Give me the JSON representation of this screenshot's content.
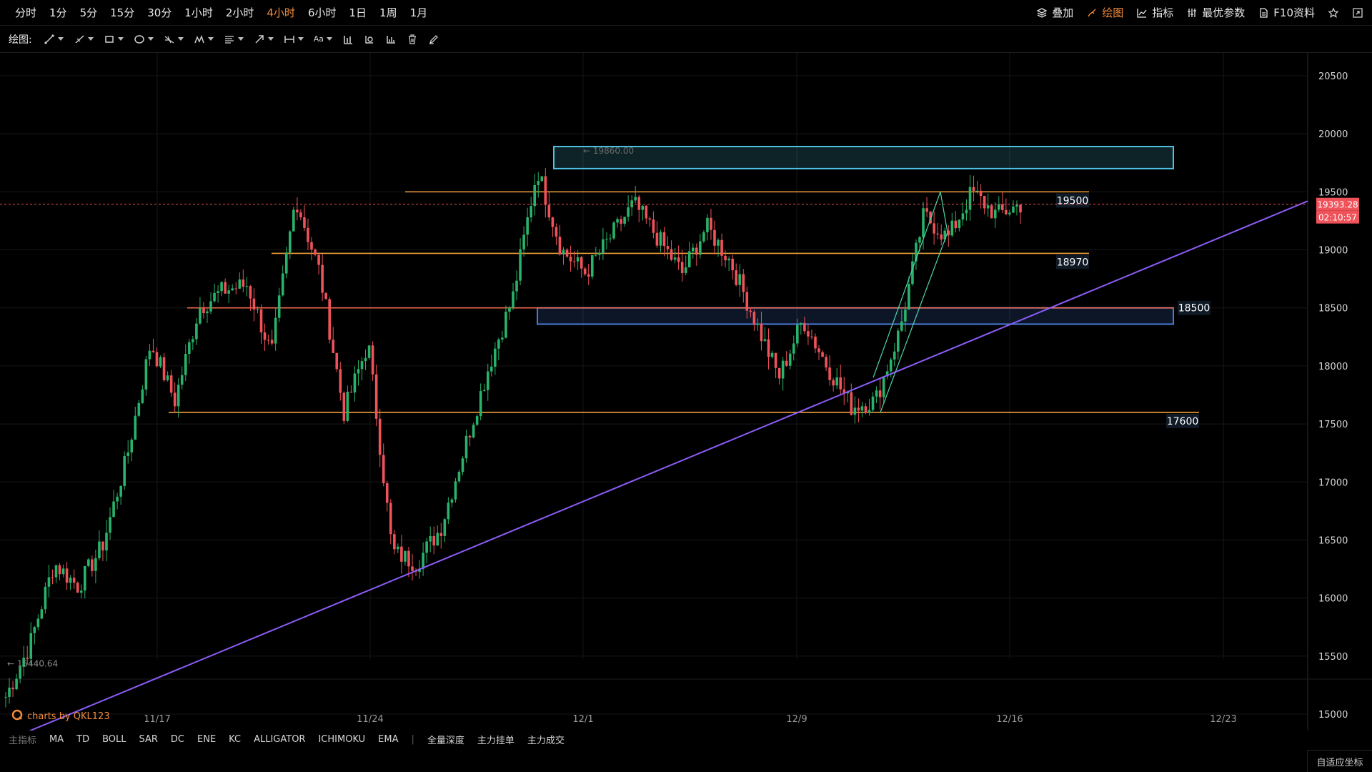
{
  "toolbar": {
    "timeframes": [
      "分时",
      "1分",
      "5分",
      "15分",
      "30分",
      "1小时",
      "2小时",
      "4小时",
      "6小时",
      "1日",
      "1周",
      "1月"
    ],
    "active_timeframe": "4小时",
    "right_items": [
      {
        "label": "叠加",
        "icon": "layers-icon",
        "active": false
      },
      {
        "label": "绘图",
        "icon": "brush-icon",
        "active": true
      },
      {
        "label": "指标",
        "icon": "indicator-icon",
        "active": false
      },
      {
        "label": "最优参数",
        "icon": "params-icon",
        "active": false
      },
      {
        "label": "F10资料",
        "icon": "document-icon",
        "active": false
      }
    ],
    "icon_buttons": [
      "star-icon",
      "fullscreen-icon"
    ]
  },
  "drawing_bar": {
    "label": "绘图:",
    "tools": [
      {
        "name": "trend-line-icon",
        "dropdown": true
      },
      {
        "name": "ray-line-icon",
        "dropdown": true
      },
      {
        "name": "rectangle-icon",
        "dropdown": true
      },
      {
        "name": "ellipse-icon",
        "dropdown": true
      },
      {
        "name": "fork-icon",
        "dropdown": true
      },
      {
        "name": "pattern-icon",
        "dropdown": true
      },
      {
        "name": "fib-icon",
        "dropdown": true
      },
      {
        "name": "arrow-icon",
        "dropdown": true
      },
      {
        "name": "measure-icon",
        "dropdown": true
      },
      {
        "name": "text-icon",
        "label": "Aa",
        "dropdown": true
      },
      {
        "name": "bars-chart-icon",
        "dropdown": false
      },
      {
        "name": "pie-chart-icon",
        "dropdown": false
      },
      {
        "name": "volume-chart-icon",
        "dropdown": false
      },
      {
        "name": "trash-icon",
        "dropdown": false
      },
      {
        "name": "pen-icon",
        "dropdown": false
      }
    ]
  },
  "indicators": {
    "label": "主指标",
    "items": [
      "MA",
      "TD",
      "BOLL",
      "SAR",
      "DC",
      "ENE",
      "KC",
      "ALLIGATOR",
      "ICHIMOKU",
      "EMA"
    ],
    "extra": [
      "全量深度",
      "主力挂单",
      "主力成交"
    ]
  },
  "watermark": "charts by QKL123",
  "auto_axis_label": "自适应坐标",
  "chart_data": {
    "type": "candlestick",
    "interval": "4h",
    "x_labels": [
      "11/17",
      "11/24",
      "12/1",
      "12/9",
      "12/16",
      "12/23"
    ],
    "ylim": [
      14800,
      20700
    ],
    "y_ticks": [
      15000,
      15500,
      16000,
      16500,
      17000,
      17500,
      18000,
      18500,
      19000,
      19500,
      20000,
      20500
    ],
    "current_price": "19393.28",
    "countdown": "02:10:57",
    "high_label": "19860.00",
    "low_label": "15440.64",
    "horizontal_levels": [
      {
        "value": 19500,
        "label": "19500",
        "color": "#f2a13a"
      },
      {
        "value": 18970,
        "label": "18970",
        "color": "#f2a13a"
      },
      {
        "value": 18500,
        "label": "18500",
        "color": "#f06a4b"
      },
      {
        "value": 17600,
        "label": "17600",
        "color": "#f2a13a"
      }
    ],
    "zones": [
      {
        "low": 19700,
        "high": 19890,
        "color": "#4fc3e0"
      },
      {
        "low": 18360,
        "high": 18500,
        "color": "#4a7ad8"
      }
    ],
    "colors": {
      "up": "#29b36a",
      "down": "#f0525a",
      "trendline": "#8b5cf6",
      "channel": "#4fd6a8",
      "background": "#000000",
      "current_price": "#f0525a"
    },
    "key_points": [
      15150,
      15600,
      16300,
      16100,
      16450,
      17200,
      18200,
      17700,
      18500,
      18650,
      18700,
      18100,
      19450,
      18800,
      17600,
      18200,
      16400,
      16300,
      16600,
      17300,
      18000,
      18600,
      19700,
      19000,
      18800,
      19100,
      19400,
      19100,
      18800,
      19200,
      18900,
      18400,
      17900,
      18400,
      18000,
      17650,
      17700,
      18300,
      19300,
      19100,
      19500,
      19300,
      19390
    ]
  }
}
